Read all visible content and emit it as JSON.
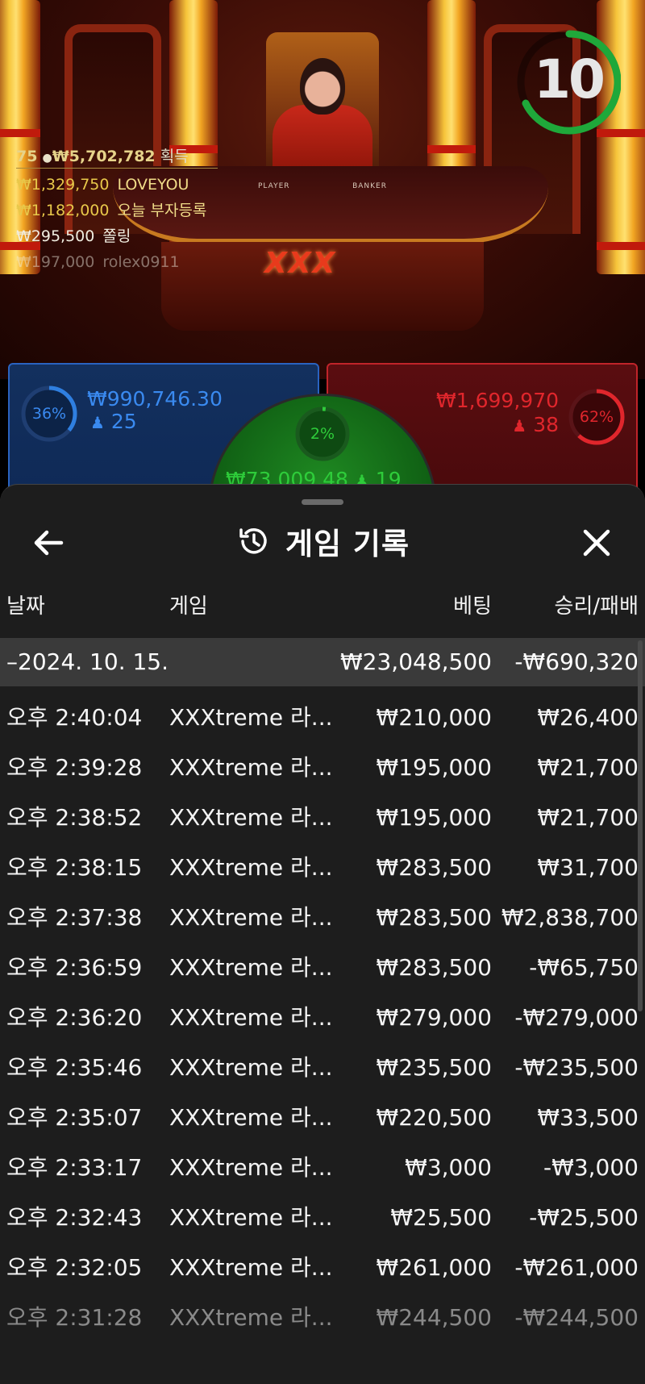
{
  "video": {
    "timer": "10",
    "table_labels": [
      "PLAYER",
      "BANKER"
    ],
    "table_logo": "XXX"
  },
  "leaderboard": {
    "players": "75",
    "total": "₩5,702,782",
    "total_suffix": "획득",
    "entries": [
      {
        "amount": "₩1,329,750",
        "name": "LOVEYOU"
      },
      {
        "amount": "₩1,182,000",
        "name": "오늘 부자등록"
      },
      {
        "amount": "₩295,500",
        "name": "쫄링"
      },
      {
        "amount": "₩197,000",
        "name": "rolex0911"
      }
    ]
  },
  "bets": {
    "player": {
      "percent": "36%",
      "percent_value": 36,
      "amount": "₩990,746.30",
      "count": "25",
      "color": "#2f7fe0"
    },
    "banker": {
      "percent": "62%",
      "percent_value": 62,
      "amount": "₩1,699,970",
      "count": "38",
      "color": "#e0262c"
    },
    "tie": {
      "percent": "2%",
      "percent_value": 2,
      "amount": "₩73,009.48",
      "count": "19",
      "color": "#2ecc3a"
    }
  },
  "sheet": {
    "title": "게임 기록",
    "columns": {
      "date": "날짜",
      "game": "게임",
      "bet": "베팅",
      "result": "승리/패배"
    },
    "date_group": {
      "date": "–2024. 10. 15.",
      "bet": "₩23,048,500",
      "result": "-₩690,320"
    },
    "rows": [
      {
        "time": "오후 2:40:04",
        "game": "XXXtreme 라...",
        "bet": "₩210,000",
        "result": "₩26,400"
      },
      {
        "time": "오후 2:39:28",
        "game": "XXXtreme 라...",
        "bet": "₩195,000",
        "result": "₩21,700"
      },
      {
        "time": "오후 2:38:52",
        "game": "XXXtreme 라...",
        "bet": "₩195,000",
        "result": "₩21,700"
      },
      {
        "time": "오후 2:38:15",
        "game": "XXXtreme 라...",
        "bet": "₩283,500",
        "result": "₩31,700"
      },
      {
        "time": "오후 2:37:38",
        "game": "XXXtreme 라...",
        "bet": "₩283,500",
        "result": "₩2,838,700"
      },
      {
        "time": "오후 2:36:59",
        "game": "XXXtreme 라...",
        "bet": "₩283,500",
        "result": "-₩65,750"
      },
      {
        "time": "오후 2:36:20",
        "game": "XXXtreme 라...",
        "bet": "₩279,000",
        "result": "-₩279,000"
      },
      {
        "time": "오후 2:35:46",
        "game": "XXXtreme 라...",
        "bet": "₩235,500",
        "result": "-₩235,500"
      },
      {
        "time": "오후 2:35:07",
        "game": "XXXtreme 라...",
        "bet": "₩220,500",
        "result": "₩33,500"
      },
      {
        "time": "오후 2:33:17",
        "game": "XXXtreme 라...",
        "bet": "₩3,000",
        "result": "-₩3,000"
      },
      {
        "time": "오후 2:32:43",
        "game": "XXXtreme 라...",
        "bet": "₩25,500",
        "result": "-₩25,500"
      },
      {
        "time": "오후 2:32:05",
        "game": "XXXtreme 라...",
        "bet": "₩261,000",
        "result": "-₩261,000"
      },
      {
        "time": "오후 2:31:28",
        "game": "XXXtreme 라...",
        "bet": "₩244,500",
        "result": "-₩244,500"
      }
    ]
  },
  "icons": {
    "back": "arrow-left-icon",
    "history": "history-icon",
    "close": "close-icon",
    "user": "user-icon"
  }
}
